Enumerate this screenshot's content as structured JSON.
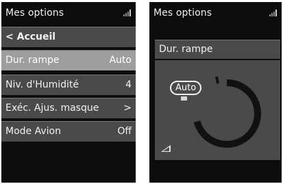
{
  "left_screen": {
    "title": "Mes options",
    "back_label": "Accueil",
    "back_glyph": "<",
    "items": [
      {
        "label": "Dur. rampe",
        "value": "Auto",
        "selected": true
      },
      {
        "label": "Niv. d'Humidité",
        "value": "4"
      },
      {
        "label": "Exéc. Ajus. masque",
        "value": ">"
      },
      {
        "label": "Mode Avion",
        "value": "Off"
      }
    ]
  },
  "right_screen": {
    "title": "Mes options",
    "header": "Dur. rampe",
    "current_value": "Auto",
    "ramp_icon": "ramp-icon"
  },
  "icons": {
    "status": "signal-strength-icon"
  },
  "colors": {
    "screen_bg": "#0c0c0c",
    "row_bg": "#4a4a4a",
    "selected_bg": "#9e9e9e",
    "text": "#f2f2f2"
  }
}
